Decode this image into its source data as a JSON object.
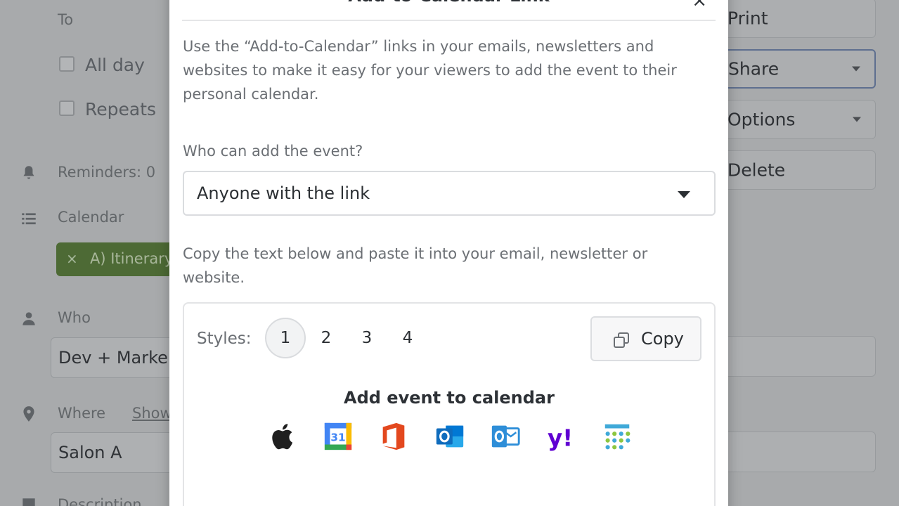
{
  "background": {
    "to_label": "To",
    "all_day_label": "All day",
    "repeats_label": "Repeats",
    "reminders_label": "Reminders: 0",
    "calendar_label": "Calendar",
    "calendar_chip": {
      "remove": "×",
      "text": "A) Itinerary"
    },
    "who_label": "Who",
    "who_value": "Dev + Marke",
    "where_label": "Where",
    "where_link": "Show",
    "where_value": "Salon A",
    "description_label": "Description",
    "right_buttons": {
      "print": "Print",
      "share": "Share",
      "options": "Options",
      "delete": "Delete"
    }
  },
  "modal": {
    "title": "Add-to-Calendar Link",
    "close": "×",
    "intro": "Use the “Add-to-Calendar” links in your emails, newsletters and websites to make it easy for your viewers to add the event to their personal calendar.",
    "who_question": "Who can add the event?",
    "who_select": "Anyone with the link",
    "copy_instructions": "Copy the text below and paste it into your email, newsletter or website.",
    "styles_label": "Styles:",
    "styles": [
      "1",
      "2",
      "3",
      "4"
    ],
    "selected_style": "1",
    "copy_button": "Copy",
    "preview_title": "Add event to calendar",
    "calendar_icons": [
      {
        "name": "apple-icon",
        "color": "#1f1f1f"
      },
      {
        "name": "google-calendar-icon",
        "color": "#4285f4",
        "day": "31"
      },
      {
        "name": "office365-icon",
        "color": "#e3481e"
      },
      {
        "name": "outlook-com-icon",
        "color": "#0f6cbd"
      },
      {
        "name": "outlook-desktop-icon",
        "color": "#2e8ed8"
      },
      {
        "name": "yahoo-icon",
        "color": "#6001d2",
        "glyph": "y!"
      },
      {
        "name": "ics-calendar-icon",
        "color": "#3fa9d8"
      }
    ]
  }
}
